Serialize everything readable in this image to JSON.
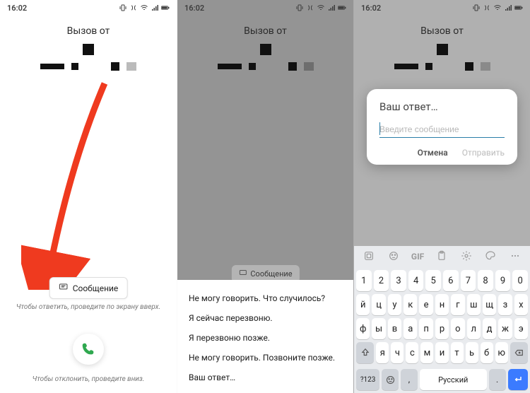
{
  "status": {
    "time": "16:02"
  },
  "call": {
    "label": "Вызов от"
  },
  "pane1": {
    "message_chip": "Сообщение",
    "hint_answer": "Чтобы ответить, проведите по экрану\nвверх.",
    "hint_decline": "Чтобы отклонить, проведите вниз."
  },
  "pane2": {
    "message_chip": "Сообщение",
    "quick_replies": [
      "Не могу говорить. Что случилось?",
      "Я сейчас перезвоню.",
      "Я перезвоню позже.",
      "Не могу говорить. Позвоните позже.",
      "Ваш ответ…"
    ]
  },
  "pane3": {
    "dialog": {
      "title": "Ваш ответ…",
      "placeholder": "Введите сообщение",
      "cancel": "Отмена",
      "send": "Отправить"
    }
  },
  "keyboard": {
    "suggest_gif": "GIF",
    "rows": [
      [
        "1",
        "2",
        "3",
        "4",
        "5",
        "6",
        "7",
        "8",
        "9",
        "0"
      ],
      [
        "й",
        "ц",
        "у",
        "к",
        "е",
        "н",
        "г",
        "ш",
        "щ",
        "з",
        "х"
      ],
      [
        "ф",
        "ы",
        "в",
        "а",
        "п",
        "р",
        "о",
        "л",
        "д",
        "ж",
        "э"
      ],
      [
        "я",
        "ч",
        "с",
        "м",
        "и",
        "т",
        "ь",
        "б",
        "ю"
      ]
    ],
    "mode_key": "?123",
    "lang_label": "Русский"
  }
}
